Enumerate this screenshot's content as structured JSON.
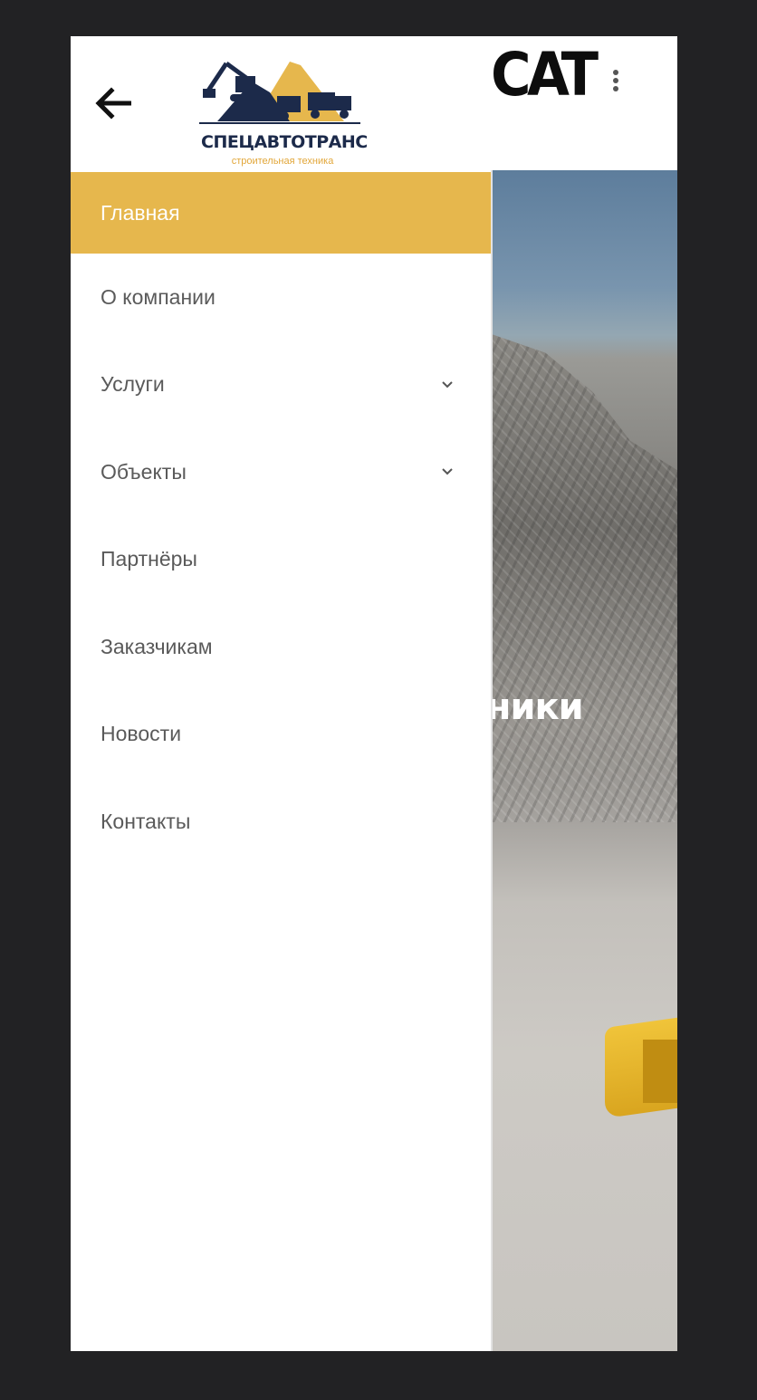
{
  "header": {
    "back_icon": "arrow-left-icon",
    "logo": {
      "title": "СПЕЦАВТОТРАНС",
      "subtitle": "строительная техника"
    },
    "brand": "CAT",
    "menu_icon": "kebab-menu-icon"
  },
  "hero": {
    "text": "хники"
  },
  "drawer": {
    "items": [
      {
        "label": "Главная",
        "active": true,
        "has_submenu": false
      },
      {
        "label": "О компании",
        "active": false,
        "has_submenu": false
      },
      {
        "label": "Услуги",
        "active": false,
        "has_submenu": true
      },
      {
        "label": "Объекты",
        "active": false,
        "has_submenu": true
      },
      {
        "label": "Партнёры",
        "active": false,
        "has_submenu": false
      },
      {
        "label": "Заказчикам",
        "active": false,
        "has_submenu": false
      },
      {
        "label": "Новости",
        "active": false,
        "has_submenu": false
      },
      {
        "label": "Контакты",
        "active": false,
        "has_submenu": false
      }
    ]
  },
  "colors": {
    "accent": "#e6b74d",
    "text": "#5a5a5a",
    "navy": "#1c2a4a",
    "orange": "#e2a73a"
  }
}
